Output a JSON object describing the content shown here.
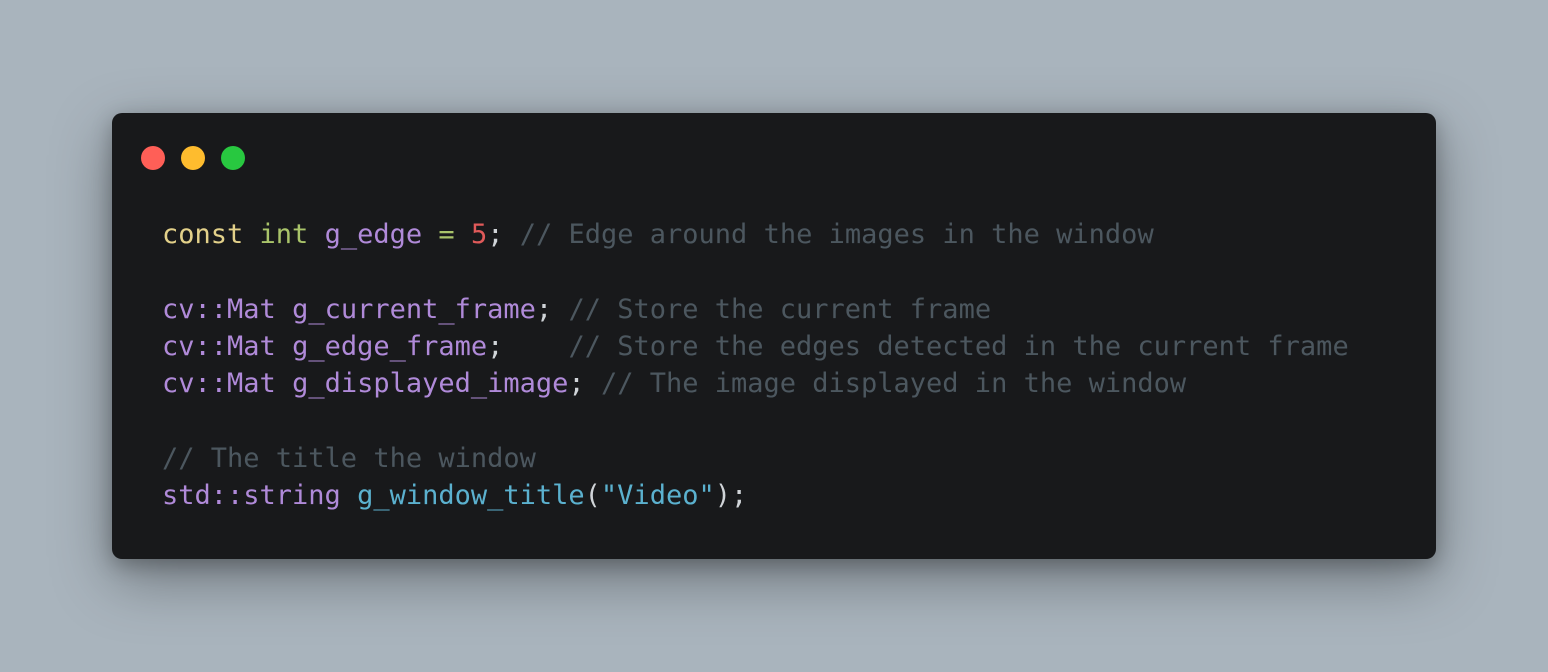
{
  "window_controls": {
    "close_color": "#ff5f57",
    "minimize_color": "#febc2e",
    "zoom_color": "#28c840"
  },
  "code": {
    "line1": {
      "kw": "const",
      "type": "int",
      "var": "g_edge",
      "op": "=",
      "num": "5",
      "end": ";",
      "comment": "// Edge around the images in the window"
    },
    "line3": {
      "type": "cv::Mat",
      "var": "g_current_frame",
      "end": ";",
      "comment": "// Store the current frame"
    },
    "line4": {
      "type": "cv::Mat",
      "var": "g_edge_frame",
      "end": ";",
      "comment": "// Store the edges detected in the current frame"
    },
    "line5": {
      "type": "cv::Mat",
      "var": "g_displayed_image",
      "end": ";",
      "comment": "// The image displayed in the window"
    },
    "line7": {
      "comment": "// The title the window"
    },
    "line8": {
      "type": "std::string",
      "fn": "g_window_title",
      "open": "(",
      "str": "\"Video\"",
      "close": ");"
    }
  }
}
